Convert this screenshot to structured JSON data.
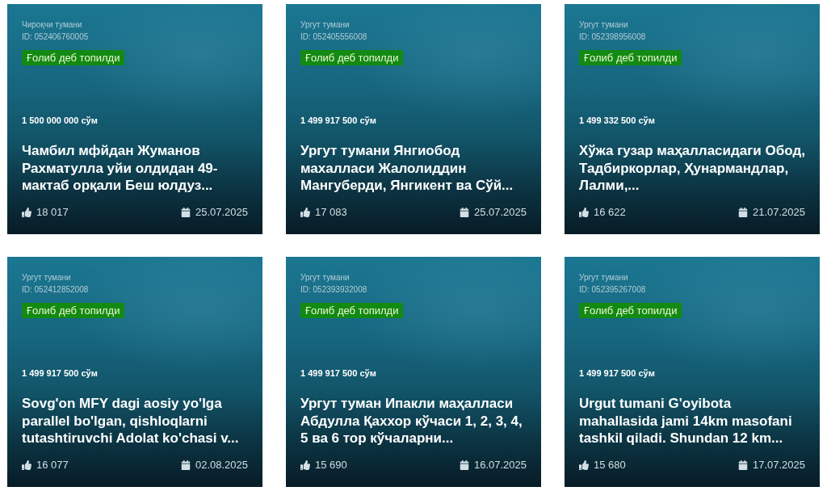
{
  "cards": [
    {
      "district": "Чироқчи тумани",
      "id": "ID: 052406760005",
      "status": "Ғолиб деб топилди",
      "amount": "1 500 000 000 сўм",
      "title": "Чамбил мфйдан Жуманов Рахматулла уйи олдидан 49-мактаб орқали Беш юлдуз...",
      "votes": "18 017",
      "date": "25.07.2025"
    },
    {
      "district": "Ургут тумани",
      "id": "ID: 052405556008",
      "status": "Ғолиб деб топилди",
      "amount": "1 499 917 500 сўм",
      "title": "Ургут тумани Янгиобод махалласи Жалолиддин Мангуберди, Янгикент ва Сўй...",
      "votes": "17 083",
      "date": "25.07.2025"
    },
    {
      "district": "Ургут тумани",
      "id": "ID: 052398956008",
      "status": "Ғолиб деб топилди",
      "amount": "1 499 332 500 сўм",
      "title": "Хўжа гузар маҳалласидаги Обод, Тадбиркорлар, Ҳунармандлар, Лалми,...",
      "votes": "16 622",
      "date": "21.07.2025"
    },
    {
      "district": "Ургут тумани",
      "id": "ID: 052412852008",
      "status": "Ғолиб деб топилди",
      "amount": "1 499 917 500 сўм",
      "title": "Sovg'on MFY dagi aosiy yo'lga parallel bo'lgan, qishloqlarni tutashtiruvchi Adolat ko'chasi v...",
      "votes": "16 077",
      "date": "02.08.2025"
    },
    {
      "district": "Ургут тумани",
      "id": "ID: 052393932008",
      "status": "Ғолиб деб топилди",
      "amount": "1 499 917 500 сўм",
      "title": "Ургут туман Ипакли маҳалласи Абдулла Қаххор кўчаси 1, 2, 3, 4, 5 ва 6 тор кўчаларни...",
      "votes": "15 690",
      "date": "16.07.2025"
    },
    {
      "district": "Ургут тумани",
      "id": "ID: 052395267008",
      "status": "Ғолиб деб топилди",
      "amount": "1 499 917 500 сўм",
      "title": "Urgut tumani G'oyibota mahallasida jami 14km masofani tashkil qiladi. Shundan 12 km...",
      "votes": "15 680",
      "date": "17.07.2025"
    }
  ]
}
